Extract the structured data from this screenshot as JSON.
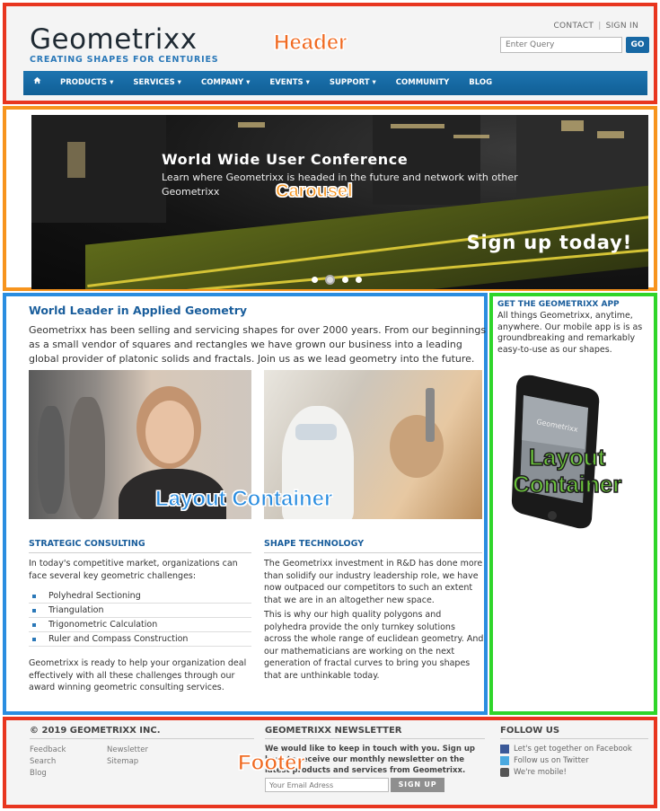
{
  "header": {
    "logo_name": "Geometrixx",
    "logo_tagline": "CREATING SHAPES FOR CENTURIES",
    "region_label": "Header",
    "toplinks": {
      "contact": "CONTACT",
      "signin": "SIGN IN"
    },
    "search": {
      "placeholder": "Enter Query",
      "button": "GO"
    },
    "nav": [
      {
        "label": "PRODUCTS ▾"
      },
      {
        "label": "SERVICES ▾"
      },
      {
        "label": "COMPANY ▾"
      },
      {
        "label": "EVENTS ▾"
      },
      {
        "label": "SUPPORT ▾"
      },
      {
        "label": "COMMUNITY"
      },
      {
        "label": "BLOG"
      }
    ],
    "home_icon": "home-icon"
  },
  "carousel": {
    "region_label": "Carousel",
    "title": "World Wide User Conference",
    "subtitle": "Learn where Geometrixx is headed in the future and network with other Geometrixx",
    "cta": "Sign up today!",
    "slide_count": 4,
    "active_slide": 2
  },
  "main": {
    "region_label": "Layout Container",
    "title": "World Leader in Applied Geometry",
    "intro": "Geometrixx has been selling and servicing shapes for over 2000 years. From our beginnings as a small vendor of squares and rectangles we have grown our business into a leading global provider of platonic solids and fractals. Join us as we lead geometry into the future.",
    "left_col": {
      "heading": "STRATEGIC CONSULTING",
      "intro": "In today's competitive market, organizations can face several key geometric challenges:",
      "bullets": [
        "Polyhedral Sectioning",
        "Triangulation",
        "Trigonometric Calculation",
        "Ruler and Compass Construction"
      ],
      "outro": "Geometrixx is ready to help your organization deal effectively with all these challenges through our award winning geometric consulting services."
    },
    "right_col": {
      "heading": "SHAPE TECHNOLOGY",
      "para1": "The Geometrixx investment in R&D has done more than solidify our industry leadership role, we have now outpaced our competitors to such an extent that we are in an altogether new space.",
      "para2": "This is why our high quality polygons and polyhedra provide the only turnkey solutions across the whole range of euclidean geometry. And our mathematicians are working on the next generation of fractal curves to bring you shapes that are unthinkable today."
    }
  },
  "side": {
    "region_label_line1": "Layout",
    "region_label_line2": "Container",
    "title": "GET THE GEOMETRIXX APP",
    "text": "All things Geometrixx, anytime, anywhere. Our mobile app is is as groundbreaking and remarkably easy-to-use as our shapes.",
    "phone_brand": "Geometrixx"
  },
  "footer": {
    "region_label": "Footer",
    "copyright": "© 2019 GEOMETRIXX INC.",
    "links_col1": [
      "Feedback",
      "Search",
      "Blog"
    ],
    "links_col2": [
      "Newsletter",
      "Sitemap"
    ],
    "newsletter": {
      "heading": "GEOMETRIXX NEWSLETTER",
      "text": "We would like to keep in touch with you. Sign up here to receive our monthly newsletter on the latest products and services from Geometrixx.",
      "placeholder": "Your Email Adress",
      "button": "SIGN UP"
    },
    "follow": {
      "heading": "FOLLOW US",
      "items": [
        {
          "label": "Let's get together on Facebook",
          "icon": "facebook-icon"
        },
        {
          "label": "Follow us on Twitter",
          "icon": "twitter-icon"
        },
        {
          "label": "We're mobile!",
          "icon": "mobile-icon"
        }
      ]
    }
  },
  "colors": {
    "header_border": "#e8361f",
    "carousel_border": "#f7941d",
    "main_border": "#2a8de0",
    "side_border": "#2fd52a",
    "nav_blue": "#1768a4",
    "title_blue": "#1a5e9c"
  }
}
